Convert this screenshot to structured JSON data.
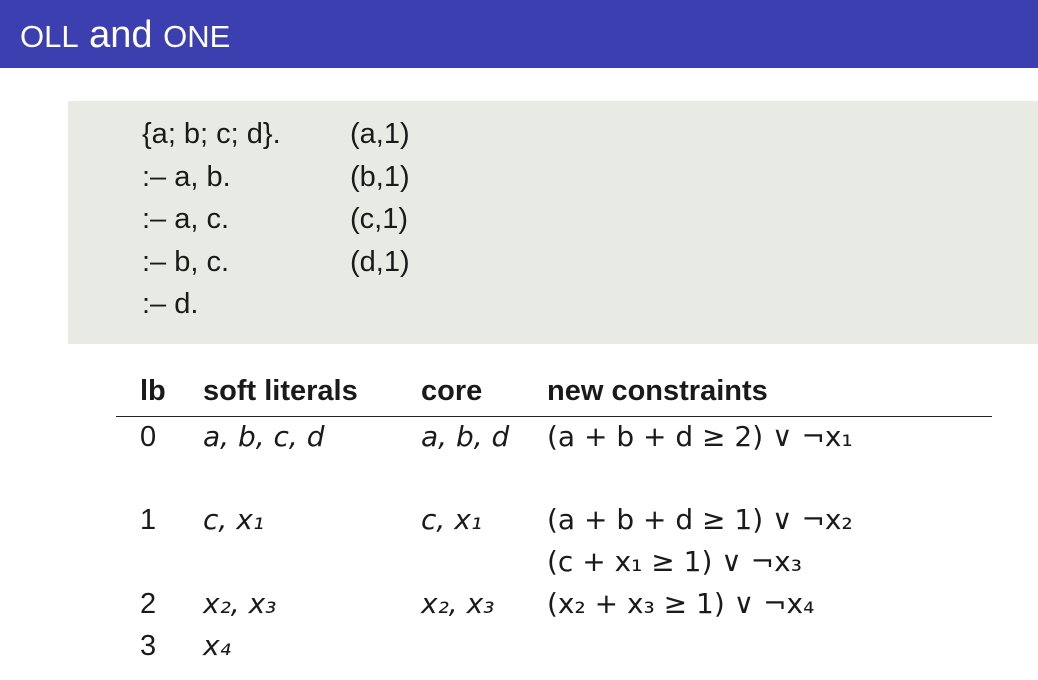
{
  "slide": {
    "title_prefix": "OLL",
    "title_middle": " and ",
    "title_suffix": "ONE"
  },
  "program": {
    "rules": [
      "{a; b; c; d}.",
      ":– a, b.",
      ":– a, c.",
      ":– b, c.",
      ":– d."
    ],
    "weights": [
      "(a,1)",
      "(b,1)",
      "(c,1)",
      "(d,1)"
    ]
  },
  "table": {
    "headers": {
      "lb": "lb",
      "soft": "soft literals",
      "core": "core",
      "new": "new constraints"
    },
    "rows": [
      {
        "lb": "0",
        "soft": "a, b, c, d",
        "core": "a, b, d",
        "new": [
          "(a + b + d ≥ 2) ∨ ¬x₁"
        ]
      },
      {
        "lb": "1",
        "soft": "c, x₁",
        "core": "c, x₁",
        "new": [
          "(a + b + d ≥ 1) ∨ ¬x₂",
          "(c + x₁ ≥ 1) ∨ ¬x₃"
        ]
      },
      {
        "lb": "2",
        "soft": "x₂, x₃",
        "core": "x₂, x₃",
        "new": [
          "(x₂ + x₃ ≥ 1) ∨ ¬x₄"
        ]
      },
      {
        "lb": "3",
        "soft": "x₄",
        "core": "",
        "new": []
      }
    ]
  }
}
